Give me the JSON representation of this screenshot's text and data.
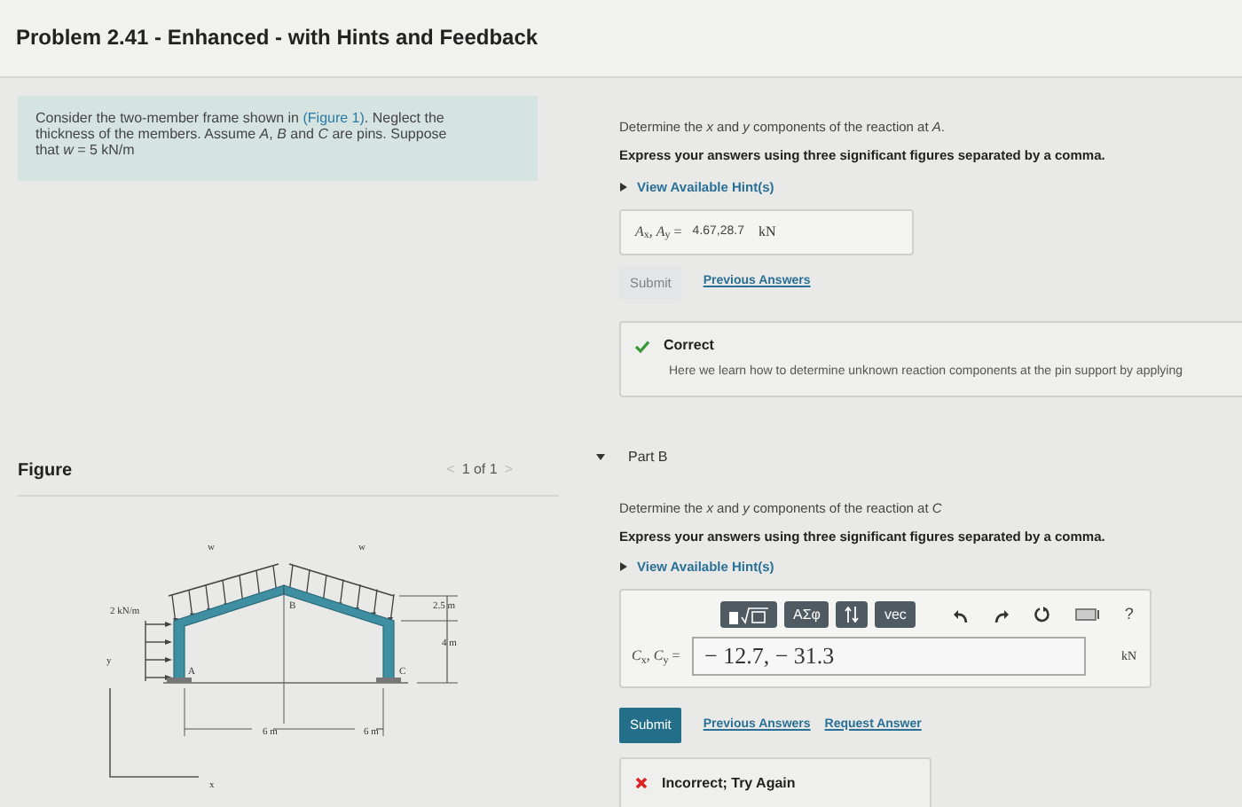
{
  "title": "Problem 2.41 - Enhanced - with Hints and Feedback",
  "intro": {
    "before": "Consider the two-member frame shown in ",
    "link": "(Figure 1)",
    "after": ". Neglect the thickness of the members. Assume *A*, *B* and *C* are pins. Suppose that *w* = 5 kN/m"
  },
  "figure": {
    "heading": "Figure",
    "prev": "<",
    "pager": "1 of 1",
    "next": ">",
    "labels": [
      "w",
      "w",
      "2 kN/m",
      "B",
      "A",
      "C",
      "2.5 m",
      "4 m",
      "y",
      "6 m",
      "6 m",
      "x"
    ]
  },
  "part_a": {
    "question": "Determine the *x* and *y* components of the reaction at *A*.",
    "instruction": "Express your answers using three significant figures separated by a comma.",
    "hints": "View Available Hint(s)",
    "answer_label": "*A*$_{x}$, *A*$_{y}$ =",
    "answer_value": "4.67,28.7",
    "unit": "kN",
    "submit": {
      "label": "Submit",
      "disabled": true
    },
    "links": [
      "Previous Answers"
    ],
    "feedback": {
      "kind": "correct",
      "title": "Correct",
      "text": "Here we learn how to determine unknown reaction components at the pin support by applying"
    }
  },
  "part_b": {
    "heading": "Part B",
    "expanded": true,
    "question": "Determine the *x* and *y* components of the reaction at *C*",
    "instruction": "Express your answers using three significant figures separated by a comma.",
    "hints": "View Available Hint(s)",
    "toolbar": [
      {
        "kind": "template"
      },
      {
        "kind": "text",
        "label": "ΑΣφ"
      },
      {
        "kind": "arrows"
      },
      {
        "kind": "text",
        "label": "vec"
      },
      {
        "kind": "undo"
      },
      {
        "kind": "redo"
      },
      {
        "kind": "reset"
      },
      {
        "kind": "keyboard"
      },
      {
        "kind": "plain",
        "label": "?"
      }
    ],
    "answer_label": "*C*$_{x}$, *C*$_{y}$ =",
    "answer_value": "− 12.7, − 31.3",
    "unit": "kN",
    "submit": {
      "label": "Submit",
      "disabled": false
    },
    "links": [
      "Previous Answers",
      "Request Answer"
    ],
    "feedback": {
      "kind": "incorrect",
      "title": "Incorrect; Try Again"
    }
  }
}
